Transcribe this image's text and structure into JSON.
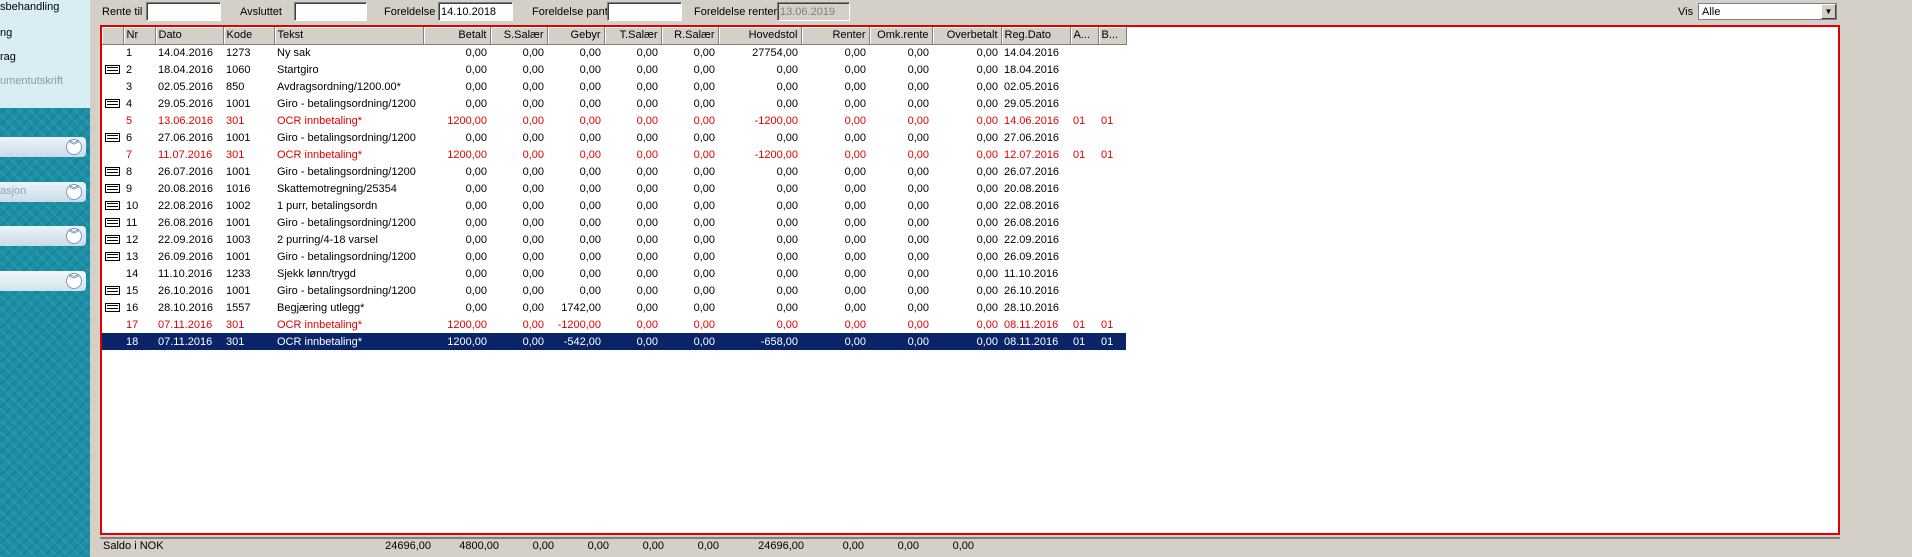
{
  "sidebar": {
    "links": [
      "sbehandling",
      "ng",
      "rag",
      "umentutskrift"
    ],
    "sections": [
      "",
      "asjon",
      "",
      ""
    ],
    "chevron": "double-chevron-down-icon"
  },
  "filter": {
    "rente_til_label": "Rente til",
    "rente_til_value": "",
    "avsluttet_label": "Avsluttet",
    "avsluttet_value": "",
    "foreldelse_label": "Foreldelse",
    "foreldelse_value": "14.10.2018",
    "foreldelse_pant_label": "Foreldelse pant",
    "foreldelse_pant_value": "",
    "foreldelse_renter_label": "Foreldelse renter",
    "foreldelse_renter_value": "13.06.2019",
    "vis_label": "Vis",
    "vis_value": "Alle"
  },
  "table": {
    "headers": [
      "",
      "Nr",
      "Dato",
      "Kode",
      "Tekst",
      "Betalt",
      "S.Salær",
      "Gebyr",
      "T.Salær",
      "R.Salær",
      "Hovedstol",
      "Renter",
      "Omk.rente",
      "Overbetalt",
      "Reg.Dato",
      "A...",
      "B..."
    ],
    "rows": [
      {
        "icon": false,
        "style": "",
        "cells": [
          "1",
          "14.04.2016",
          "1273",
          "Ny sak",
          "0,00",
          "0,00",
          "0,00",
          "0,00",
          "0,00",
          "27754,00",
          "0,00",
          "0,00",
          "0,00",
          "14.04.2016",
          "",
          ""
        ]
      },
      {
        "icon": true,
        "style": "",
        "cells": [
          "2",
          "18.04.2016",
          "1060",
          "Startgiro",
          "0,00",
          "0,00",
          "0,00",
          "0,00",
          "0,00",
          "0,00",
          "0,00",
          "0,00",
          "0,00",
          "18.04.2016",
          "",
          ""
        ]
      },
      {
        "icon": false,
        "style": "",
        "cells": [
          "3",
          "02.05.2016",
          "850",
          "Avdragsordning/1200.00*",
          "0,00",
          "0,00",
          "0,00",
          "0,00",
          "0,00",
          "0,00",
          "0,00",
          "0,00",
          "0,00",
          "02.05.2016",
          "",
          ""
        ]
      },
      {
        "icon": true,
        "style": "",
        "cells": [
          "4",
          "29.05.2016",
          "1001",
          "Giro - betalingsordning/1200",
          "0,00",
          "0,00",
          "0,00",
          "0,00",
          "0,00",
          "0,00",
          "0,00",
          "0,00",
          "0,00",
          "29.05.2016",
          "",
          ""
        ]
      },
      {
        "icon": false,
        "style": "red",
        "cells": [
          "5",
          "13.06.2016",
          "301",
          "OCR innbetaling*",
          "1200,00",
          "0,00",
          "0,00",
          "0,00",
          "0,00",
          "-1200,00",
          "0,00",
          "0,00",
          "0,00",
          "14.06.2016",
          "01",
          "01"
        ]
      },
      {
        "icon": true,
        "style": "",
        "cells": [
          "6",
          "27.06.2016",
          "1001",
          "Giro - betalingsordning/1200",
          "0,00",
          "0,00",
          "0,00",
          "0,00",
          "0,00",
          "0,00",
          "0,00",
          "0,00",
          "0,00",
          "27.06.2016",
          "",
          ""
        ]
      },
      {
        "icon": false,
        "style": "red",
        "cells": [
          "7",
          "11.07.2016",
          "301",
          "OCR innbetaling*",
          "1200,00",
          "0,00",
          "0,00",
          "0,00",
          "0,00",
          "-1200,00",
          "0,00",
          "0,00",
          "0,00",
          "12.07.2016",
          "01",
          "01"
        ]
      },
      {
        "icon": true,
        "style": "",
        "cells": [
          "8",
          "26.07.2016",
          "1001",
          "Giro - betalingsordning/1200",
          "0,00",
          "0,00",
          "0,00",
          "0,00",
          "0,00",
          "0,00",
          "0,00",
          "0,00",
          "0,00",
          "26.07.2016",
          "",
          ""
        ]
      },
      {
        "icon": true,
        "style": "",
        "cells": [
          "9",
          "20.08.2016",
          "1016",
          "Skattemotregning/25354",
          "0,00",
          "0,00",
          "0,00",
          "0,00",
          "0,00",
          "0,00",
          "0,00",
          "0,00",
          "0,00",
          "20.08.2016",
          "",
          ""
        ]
      },
      {
        "icon": true,
        "style": "",
        "cells": [
          "10",
          "22.08.2016",
          "1002",
          "1 purr, betalingsordn",
          "0,00",
          "0,00",
          "0,00",
          "0,00",
          "0,00",
          "0,00",
          "0,00",
          "0,00",
          "0,00",
          "22.08.2016",
          "",
          ""
        ]
      },
      {
        "icon": true,
        "style": "",
        "cells": [
          "11",
          "26.08.2016",
          "1001",
          "Giro - betalingsordning/1200",
          "0,00",
          "0,00",
          "0,00",
          "0,00",
          "0,00",
          "0,00",
          "0,00",
          "0,00",
          "0,00",
          "26.08.2016",
          "",
          ""
        ]
      },
      {
        "icon": true,
        "style": "",
        "cells": [
          "12",
          "22.09.2016",
          "1003",
          "2 purring/4-18 varsel",
          "0,00",
          "0,00",
          "0,00",
          "0,00",
          "0,00",
          "0,00",
          "0,00",
          "0,00",
          "0,00",
          "22.09.2016",
          "",
          ""
        ]
      },
      {
        "icon": true,
        "style": "",
        "cells": [
          "13",
          "26.09.2016",
          "1001",
          "Giro - betalingsordning/1200",
          "0,00",
          "0,00",
          "0,00",
          "0,00",
          "0,00",
          "0,00",
          "0,00",
          "0,00",
          "0,00",
          "26.09.2016",
          "",
          ""
        ]
      },
      {
        "icon": false,
        "style": "",
        "cells": [
          "14",
          "11.10.2016",
          "1233",
          "Sjekk lønn/trygd",
          "0,00",
          "0,00",
          "0,00",
          "0,00",
          "0,00",
          "0,00",
          "0,00",
          "0,00",
          "0,00",
          "11.10.2016",
          "",
          ""
        ]
      },
      {
        "icon": true,
        "style": "",
        "cells": [
          "15",
          "26.10.2016",
          "1001",
          "Giro - betalingsordning/1200",
          "0,00",
          "0,00",
          "0,00",
          "0,00",
          "0,00",
          "0,00",
          "0,00",
          "0,00",
          "0,00",
          "26.10.2016",
          "",
          ""
        ]
      },
      {
        "icon": true,
        "style": "",
        "cells": [
          "16",
          "28.10.2016",
          "1557",
          "Begjæring utlegg*",
          "0,00",
          "0,00",
          "1742,00",
          "0,00",
          "0,00",
          "0,00",
          "0,00",
          "0,00",
          "0,00",
          "28.10.2016",
          "",
          ""
        ]
      },
      {
        "icon": false,
        "style": "red",
        "cells": [
          "17",
          "07.11.2016",
          "301",
          "OCR innbetaling*",
          "1200,00",
          "0,00",
          "-1200,00",
          "0,00",
          "0,00",
          "0,00",
          "0,00",
          "0,00",
          "0,00",
          "08.11.2016",
          "01",
          "01"
        ]
      },
      {
        "icon": false,
        "style": "sel",
        "cells": [
          "18",
          "07.11.2016",
          "301",
          "OCR innbetaling*",
          "1200,00",
          "0,00",
          "-542,00",
          "0,00",
          "0,00",
          "-658,00",
          "0,00",
          "0,00",
          "0,00",
          "08.11.2016",
          "01",
          "01"
        ]
      }
    ]
  },
  "footer": {
    "rows": [
      {
        "label": "Saldo i NOK",
        "values": [
          "24696,00",
          "4800,00",
          "0,00",
          "0,00",
          "0,00",
          "0,00",
          "24696,00",
          "0,00",
          "0,00",
          "0,00"
        ]
      }
    ]
  },
  "colors": {
    "accent_red": "#e00000",
    "selection": "#0a246a",
    "sidebar": "#1a8fa6"
  }
}
